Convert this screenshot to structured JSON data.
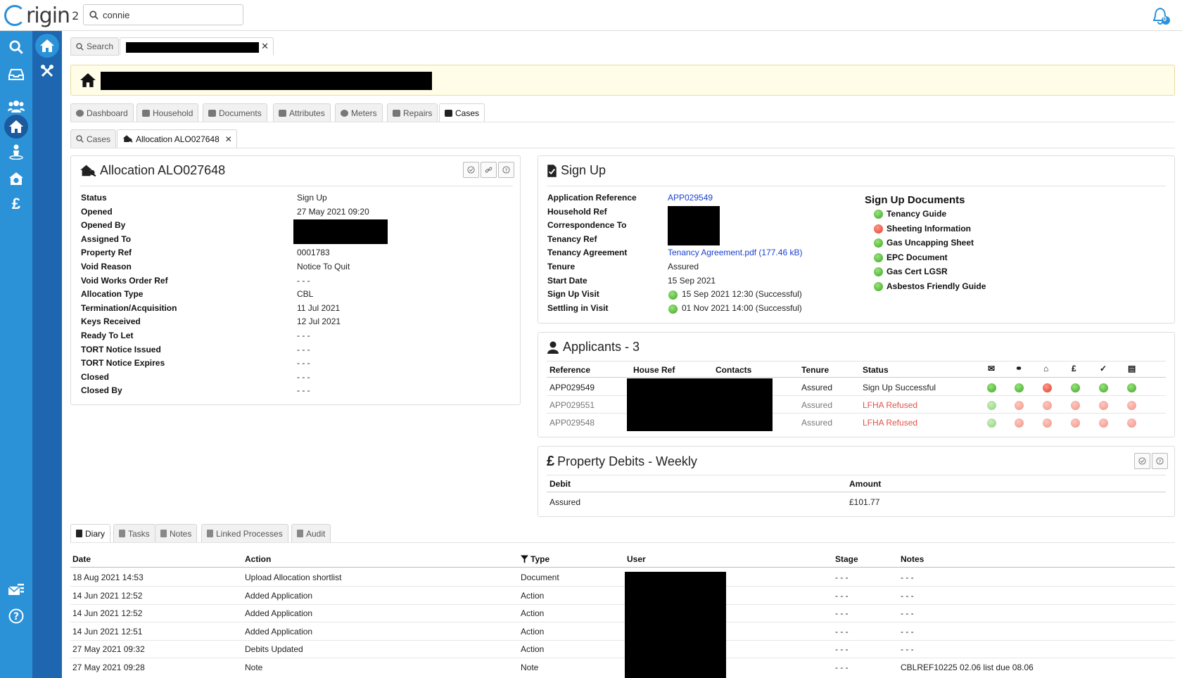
{
  "app": {
    "logo_text": "rigin",
    "logo_sup": "2",
    "search_value": "connie",
    "notification_count": "0"
  },
  "colors": {
    "rail_light": "#2b92d8",
    "rail_dark": "#1e66b0",
    "banner_bg": "#fffde8",
    "link": "#1a3fd0",
    "status_green": "#3aa628",
    "status_red": "#e03a2a"
  },
  "rail_icons": [
    "search-icon",
    "inbox-icon",
    "users-icon",
    "home-icon",
    "person-icon",
    "house-plus-icon",
    "pound-icon",
    "mail-list-icon",
    "help-icon"
  ],
  "rail2_icons": [
    "home-icon",
    "tools-icon"
  ],
  "top_tabs": {
    "search": "Search"
  },
  "record_tabs": [
    "Dashboard",
    "Household",
    "Documents",
    "Attributes",
    "Meters",
    "Repairs",
    "Cases"
  ],
  "case_tabs": {
    "cases": "Cases",
    "allocation": "Allocation ALO027648"
  },
  "allocation": {
    "title": "Allocation ALO027648",
    "rows": [
      {
        "label": "Status",
        "value": "Sign Up"
      },
      {
        "label": "Opened",
        "value": "27 May 2021 09:20"
      },
      {
        "label": "Opened By",
        "value": ""
      },
      {
        "label": "Assigned To",
        "value": ""
      },
      {
        "label": "Property Ref",
        "value": "0001783"
      },
      {
        "label": "Void Reason",
        "value": "Notice To Quit"
      },
      {
        "label": "Void Works Order Ref",
        "value": "- - -"
      },
      {
        "label": "Allocation Type",
        "value": "CBL"
      },
      {
        "label": "Termination/Acquisition",
        "value": "11 Jul 2021"
      },
      {
        "label": "Keys Received",
        "value": "12 Jul 2021"
      },
      {
        "label": "Ready To Let",
        "value": "- - -"
      },
      {
        "label": "TORT Notice Issued",
        "value": "- - -"
      },
      {
        "label": "TORT Notice Expires",
        "value": "- - -"
      },
      {
        "label": "Closed",
        "value": "- - -"
      },
      {
        "label": "Closed By",
        "value": "- - -"
      }
    ]
  },
  "signup": {
    "title": "Sign Up",
    "rows": [
      {
        "label": "Application Reference",
        "value": "APP029549"
      },
      {
        "label": "Household Ref",
        "value": ""
      },
      {
        "label": "Correspondence To",
        "value": ""
      },
      {
        "label": "Tenancy Ref",
        "value": ""
      },
      {
        "label": "Tenancy Agreement",
        "value": "Tenancy Agreement.pdf (177.46 kB)"
      },
      {
        "label": "Tenure",
        "value": "Assured"
      },
      {
        "label": "Start Date",
        "value": "15 Sep 2021"
      },
      {
        "label": "Sign Up Visit",
        "value": "15 Sep 2021 12:30 (Successful)"
      },
      {
        "label": "Settling in Visit",
        "value": "01 Nov 2021 14:00 (Successful)"
      }
    ],
    "docs_title": "Sign Up Documents",
    "docs": [
      {
        "name": "Tenancy Guide",
        "status": "green"
      },
      {
        "name": "Sheeting Information",
        "status": "red"
      },
      {
        "name": "Gas Uncapping Sheet",
        "status": "green"
      },
      {
        "name": "EPC Document",
        "status": "green"
      },
      {
        "name": "Gas Cert LGSR",
        "status": "green"
      },
      {
        "name": "Asbestos Friendly Guide",
        "status": "green"
      }
    ]
  },
  "applicants": {
    "title": "Applicants - 3",
    "headers": {
      "reference": "Reference",
      "house_ref": "House Ref",
      "contacts": "Contacts",
      "tenure": "Tenure",
      "status": "Status"
    },
    "header_icons": [
      "envelope-icon",
      "handshake-icon",
      "home-icon",
      "pound-icon",
      "user-check-icon",
      "document-icon"
    ],
    "rows": [
      {
        "reference": "APP029549",
        "tenure": "Assured",
        "status": "Sign Up Successful",
        "dots": [
          "g",
          "g",
          "r",
          "g",
          "g",
          "g"
        ]
      },
      {
        "reference": "APP029551",
        "tenure": "Assured",
        "status": "LFHA Refused",
        "dots": [
          "g",
          "r",
          "r",
          "r",
          "r",
          "r"
        ]
      },
      {
        "reference": "APP029548",
        "tenure": "Assured",
        "status": "LFHA Refused",
        "dots": [
          "g",
          "r",
          "r",
          "r",
          "r",
          "r"
        ]
      }
    ]
  },
  "debits": {
    "title": "Property Debits - Weekly",
    "headers": {
      "debit": "Debit",
      "amount": "Amount"
    },
    "rows": [
      {
        "debit": "Assured",
        "amount": "£101.77"
      }
    ]
  },
  "bottom_tabs": [
    "Diary",
    "Tasks",
    "Notes",
    "Linked Processes",
    "Audit"
  ],
  "diary": {
    "headers": {
      "date": "Date",
      "action": "Action",
      "type": "Type",
      "user": "User",
      "stage": "Stage",
      "notes": "Notes"
    },
    "rows": [
      {
        "date": "18 Aug 2021 14:53",
        "action": "Upload Allocation shortlist",
        "type": "Document",
        "stage": "- - -",
        "notes": "- - -"
      },
      {
        "date": "14 Jun 2021 12:52",
        "action": "Added Application",
        "type": "Action",
        "stage": "- - -",
        "notes": "- - -"
      },
      {
        "date": "14 Jun 2021 12:52",
        "action": "Added Application",
        "type": "Action",
        "stage": "- - -",
        "notes": "- - -"
      },
      {
        "date": "14 Jun 2021 12:51",
        "action": "Added Application",
        "type": "Action",
        "stage": "- - -",
        "notes": "- - -"
      },
      {
        "date": "27 May 2021 09:32",
        "action": "Debits Updated",
        "type": "Action",
        "stage": "- - -",
        "notes": "- - -"
      },
      {
        "date": "27 May 2021 09:28",
        "action": "Note",
        "type": "Note",
        "stage": "- - -",
        "notes": "CBLREF10225 02.06 list due 08.06"
      }
    ]
  }
}
